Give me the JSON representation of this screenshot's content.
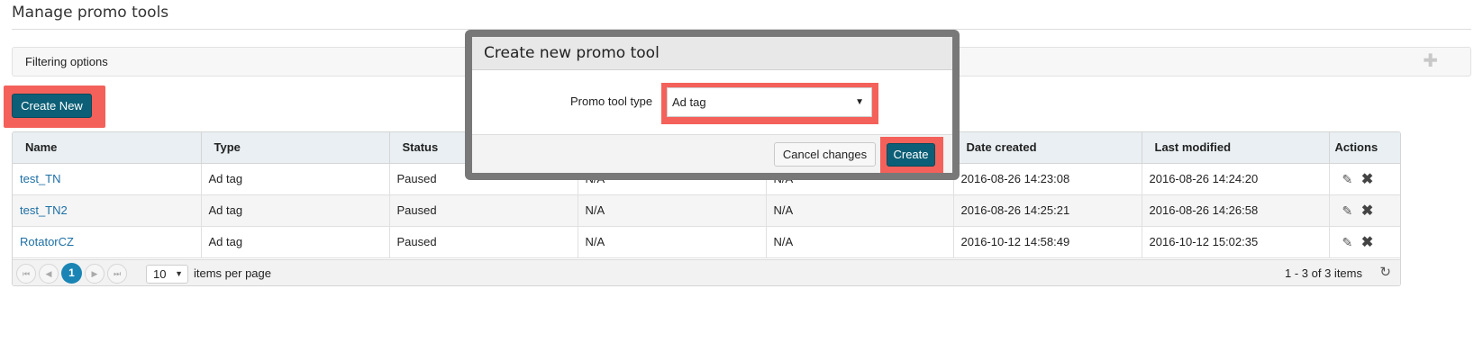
{
  "page": {
    "title": "Manage promo tools"
  },
  "filter": {
    "label": "Filtering options",
    "expand_icon": "plus-icon"
  },
  "toolbar": {
    "create_new_label": "Create New"
  },
  "table": {
    "columns": [
      "Name",
      "Type",
      "Status",
      "",
      "",
      "Date created",
      "Last modified",
      "Actions"
    ],
    "rows": [
      {
        "name": "test_TN",
        "type": "Ad tag",
        "status": "Paused",
        "col4": "N/A",
        "col5": "N/A",
        "date_created": "2016-08-26 14:23:08",
        "last_modified": "2016-08-26 14:24:20"
      },
      {
        "name": "test_TN2",
        "type": "Ad tag",
        "status": "Paused",
        "col4": "N/A",
        "col5": "N/A",
        "date_created": "2016-08-26 14:25:21",
        "last_modified": "2016-08-26 14:26:58"
      },
      {
        "name": "RotatorCZ",
        "type": "Ad tag",
        "status": "Paused",
        "col4": "N/A",
        "col5": "N/A",
        "date_created": "2016-10-12 14:58:49",
        "last_modified": "2016-10-12 15:02:35"
      }
    ],
    "action_icons": [
      "pencil-icon",
      "delete-x-icon"
    ]
  },
  "pager": {
    "current_page": "1",
    "page_size": "10",
    "items_per_page_label": "items per page",
    "info": "1 - 3 of 3 items"
  },
  "modal": {
    "title": "Create new promo tool",
    "type_label": "Promo tool type",
    "type_value": "Ad tag",
    "cancel_label": "Cancel changes",
    "create_label": "Create"
  },
  "colors": {
    "primary_button": "#0c5f76",
    "highlight": "#f4615a",
    "link": "#1d6fa5",
    "active_page": "#1a85b5"
  }
}
